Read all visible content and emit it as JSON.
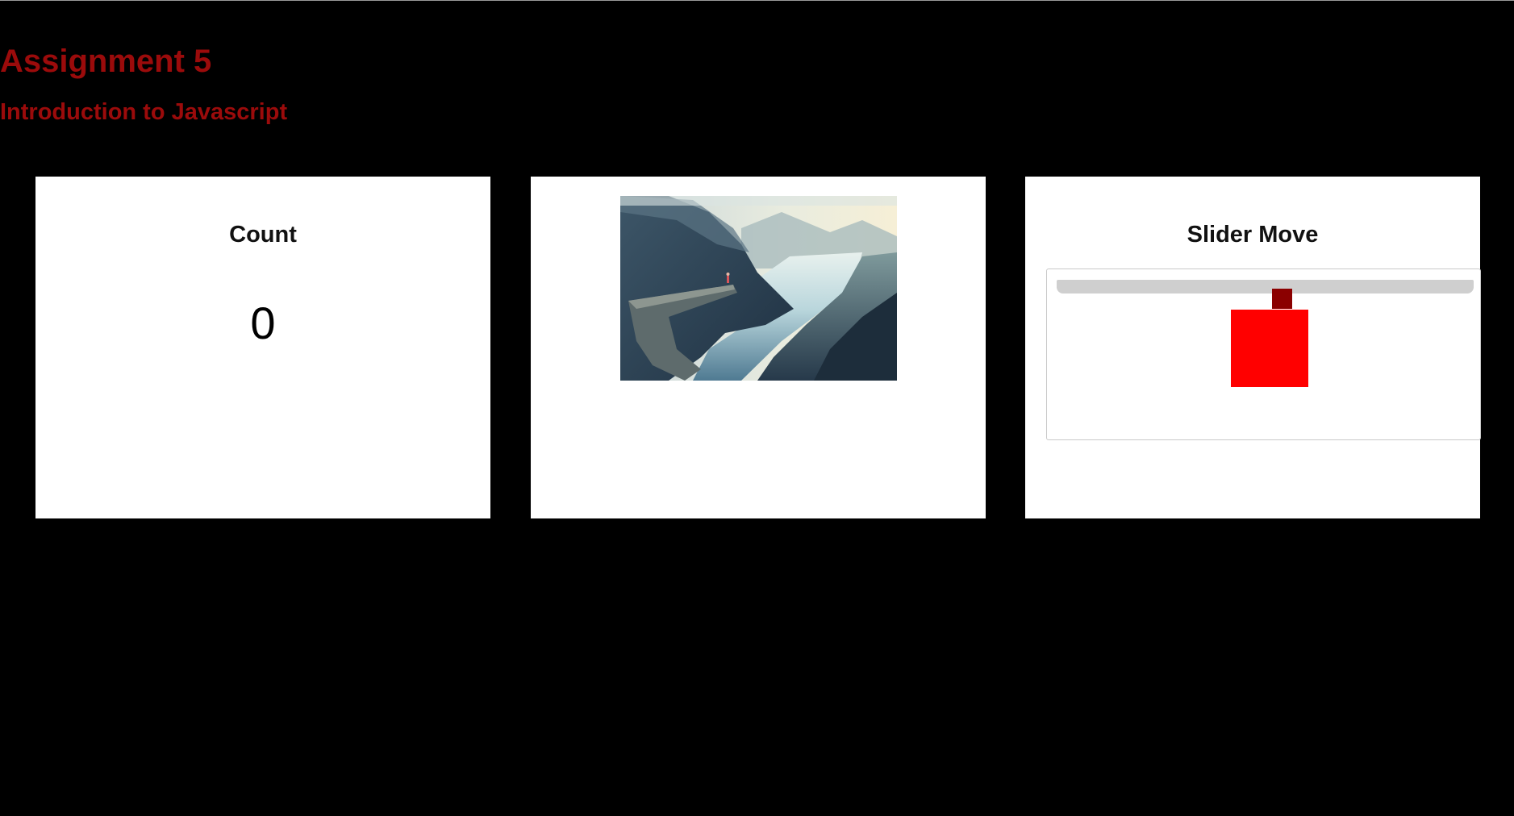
{
  "header": {
    "title": "Assignment 5",
    "subtitle": "Introduction to Javascript"
  },
  "count_card": {
    "title": "Count",
    "value": "0"
  },
  "image_card": {
    "image_subject": "landscape-photo"
  },
  "slider_card": {
    "title": "Slider Move",
    "slider_value_percent": 54,
    "thumb_color": "#8b0000",
    "box_color": "#ff0000"
  },
  "colors": {
    "background": "#000000",
    "accent": "#9b0b0b",
    "card": "#ffffff"
  }
}
